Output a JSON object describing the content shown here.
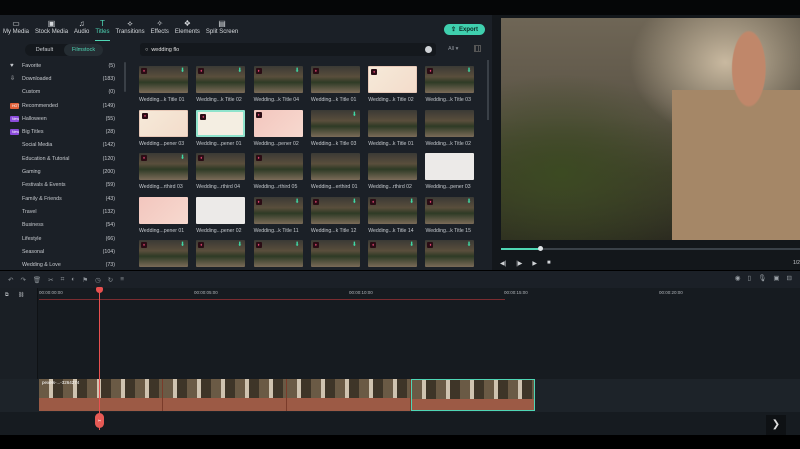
{
  "nav": [
    {
      "label": "My Media",
      "icon": "folder-icon"
    },
    {
      "label": "Stock Media",
      "icon": "image-icon"
    },
    {
      "label": "Audio",
      "icon": "music-icon"
    },
    {
      "label": "Titles",
      "icon": "text-icon",
      "active": true
    },
    {
      "label": "Transitions",
      "icon": "transition-icon"
    },
    {
      "label": "Effects",
      "icon": "effects-icon"
    },
    {
      "label": "Elements",
      "icon": "elements-icon"
    },
    {
      "label": "Split Screen",
      "icon": "split-screen-icon"
    }
  ],
  "export_label": "Export",
  "tabs": {
    "default": "Default",
    "filmstock": "Filmstock"
  },
  "search": {
    "value": "wedding flo"
  },
  "filter": "All",
  "categories": [
    {
      "label": "Favorite",
      "count": "(5)",
      "icon": "♥"
    },
    {
      "label": "Downloaded",
      "count": "(183)",
      "icon": "⇩"
    },
    {
      "label": "Custom",
      "count": "(0)"
    },
    {
      "label": "Recommended",
      "count": "(149)",
      "badge": "HOT"
    },
    {
      "label": "Halloween",
      "count": "(55)",
      "badge": "New"
    },
    {
      "label": "Big Titles",
      "count": "(28)",
      "badge": "New"
    },
    {
      "label": "Social Media",
      "count": "(142)"
    },
    {
      "label": "Education & Tutorial",
      "count": "(120)"
    },
    {
      "label": "Gaming",
      "count": "(200)"
    },
    {
      "label": "Festivals & Events",
      "count": "(59)"
    },
    {
      "label": "Family & Friends",
      "count": "(43)"
    },
    {
      "label": "Travel",
      "count": "(132)"
    },
    {
      "label": "Business",
      "count": "(54)"
    },
    {
      "label": "Lifestyle",
      "count": "(66)"
    },
    {
      "label": "Seasonal",
      "count": "(104)"
    },
    {
      "label": "Wedding & Love",
      "count": "(73)"
    }
  ],
  "grid": [
    {
      "label": "Wedding...k Title 01",
      "style": "dark",
      "dl": true
    },
    {
      "label": "Wedding...k Title 02",
      "style": "dark",
      "dl": true
    },
    {
      "label": "Wedding...k Title 04",
      "style": "dark",
      "dl": true
    },
    {
      "label": "Wedding...k Title 01",
      "style": "dark",
      "dl": false
    },
    {
      "label": "Wedding...k Title 02",
      "style": "light",
      "dl": false
    },
    {
      "label": "Wedding...k Title 03",
      "style": "dark",
      "dl": true
    },
    {
      "label": "Wedding...pener 03",
      "style": "light",
      "dl": false
    },
    {
      "label": "Wedding...pener 01",
      "style": "mint",
      "dl": false
    },
    {
      "label": "Wedding...pener 02",
      "style": "pink",
      "dl": false
    },
    {
      "label": "Wedding...k Title 03",
      "style": "dark",
      "dl": true,
      "nofav": true
    },
    {
      "label": "Wedding...k Title 01",
      "style": "dark",
      "dl": false,
      "nofav": true
    },
    {
      "label": "Wedding...k Title 02",
      "style": "dark",
      "dl": false,
      "nofav": true
    },
    {
      "label": "Wedding...rthird 03",
      "style": "dark",
      "dl": true
    },
    {
      "label": "Wedding...rthird 04",
      "style": "dark",
      "dl": false
    },
    {
      "label": "Wedding...rthird 05",
      "style": "dark",
      "dl": false
    },
    {
      "label": "Wedding...erthird 01",
      "style": "dark",
      "dl": false,
      "nofav": true
    },
    {
      "label": "Wedding...rthird 02",
      "style": "dark",
      "dl": false,
      "nofav": true
    },
    {
      "label": "Wedding...pener 03",
      "style": "white",
      "dl": false,
      "nofav": true
    },
    {
      "label": "Wedding...pener 01",
      "style": "pink",
      "dl": false,
      "nofav": true
    },
    {
      "label": "Wedding...pener 02",
      "style": "white",
      "dl": false,
      "nofav": true
    },
    {
      "label": "Wedding...k Title 11",
      "style": "dark",
      "dl": true
    },
    {
      "label": "Wedding...k Title 12",
      "style": "dark",
      "dl": true
    },
    {
      "label": "Wedding...k Title 14",
      "style": "dark",
      "dl": true
    },
    {
      "label": "Wedding...k Title 15",
      "style": "dark",
      "dl": true
    },
    {
      "label": "",
      "style": "dark",
      "dl": true
    },
    {
      "label": "",
      "style": "dark",
      "dl": true
    },
    {
      "label": "",
      "style": "dark",
      "dl": true
    },
    {
      "label": "",
      "style": "dark",
      "dl": true
    },
    {
      "label": "",
      "style": "dark",
      "dl": true
    },
    {
      "label": "",
      "style": "dark",
      "dl": true
    }
  ],
  "player": {
    "progress": 0.13,
    "page": "1/2"
  },
  "ruler": [
    "00:00:00:00",
    "00:00:05:00",
    "00:00:10:00",
    "00:00:15:00",
    "00:00:20:00"
  ],
  "clips": [
    {
      "name": "pexels-...-3264274"
    },
    {
      "name": ""
    },
    {
      "name": ""
    },
    {
      "name": ""
    }
  ],
  "colors": {
    "accent": "#4fd6b5",
    "playhead": "#e8504f",
    "clip": "#9c5a45"
  }
}
